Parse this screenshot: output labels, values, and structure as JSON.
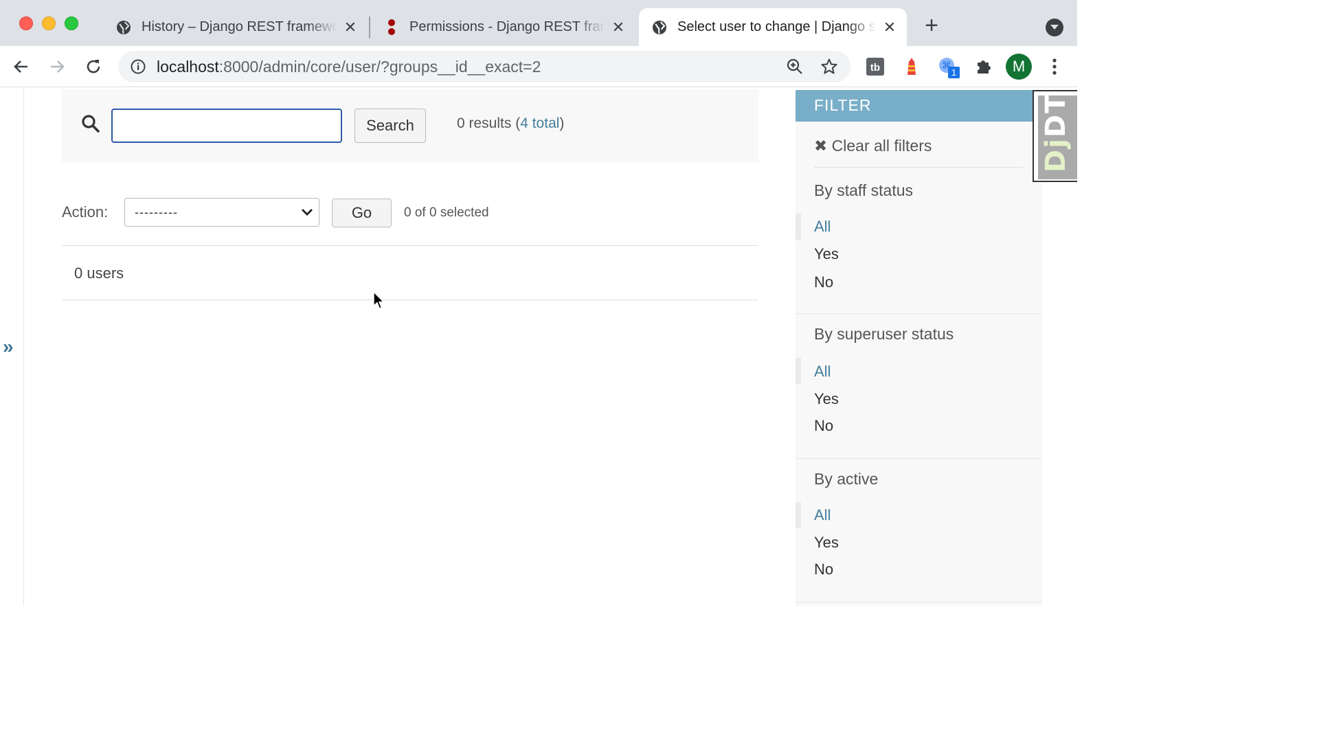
{
  "browser": {
    "tabs": [
      {
        "title": "History – Django REST framework",
        "favicon": "globe-icon",
        "active": false
      },
      {
        "title": "Permissions - Django REST framework",
        "favicon": "drf-icon",
        "active": false
      },
      {
        "title": "Select user to change | Django site admin",
        "favicon": "globe-icon",
        "active": true
      }
    ],
    "close_glyph": "✕",
    "new_tab_glyph": "+",
    "url_host": "localhost",
    "url_rest": ":8000/admin/core/user/?groups__id__exact=2",
    "avatar_letter": "M",
    "extension_badge": "1"
  },
  "search": {
    "input_value": "",
    "button_label": "Search",
    "results_prefix": "0 results (",
    "results_total_link": "4 total",
    "results_suffix": ")"
  },
  "actions": {
    "label": "Action:",
    "selected_option": "---------",
    "go_label": "Go",
    "selected_count": "0 of 0 selected"
  },
  "list": {
    "count_label": "0 users"
  },
  "sidebar_toggle": "»",
  "filter": {
    "header": "FILTER",
    "clear_all": "✖ Clear all filters",
    "sections": [
      {
        "title": "By staff status",
        "options": [
          "All",
          "Yes",
          "No"
        ],
        "selected": "All"
      },
      {
        "title": "By superuser status",
        "options": [
          "All",
          "Yes",
          "No"
        ],
        "selected": "All"
      },
      {
        "title": "By active",
        "options": [
          "All",
          "Yes",
          "No"
        ],
        "selected": "All"
      }
    ]
  },
  "djdt": {
    "label_dj": "Dj",
    "label_dt": "DT"
  },
  "colors": {
    "accent_link": "#447e9b",
    "filter_header": "#79aec8",
    "focus_border": "#2b59a9"
  }
}
